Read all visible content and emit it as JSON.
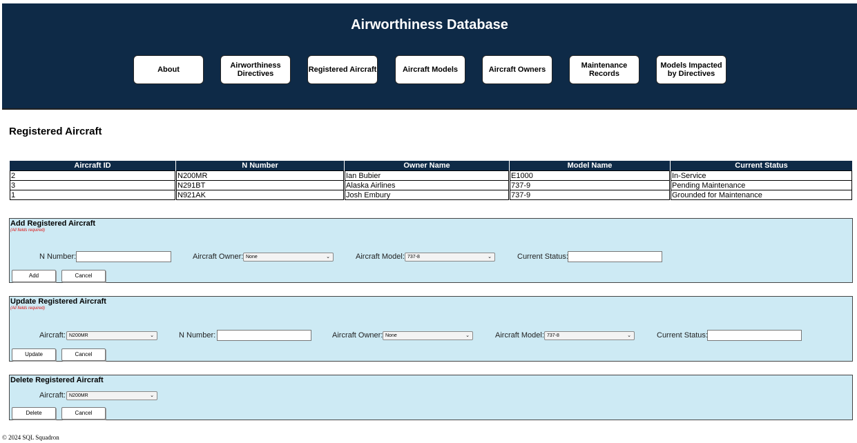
{
  "header": {
    "title": "Airworthiness Database",
    "nav": [
      {
        "label": "About"
      },
      {
        "label": "Airworthiness Directives"
      },
      {
        "label": "Registered Aircraft"
      },
      {
        "label": "Aircraft Models"
      },
      {
        "label": "Aircraft Owners"
      },
      {
        "label": "Maintenance Records"
      },
      {
        "label": "Models Impacted by Directives"
      }
    ]
  },
  "page": {
    "title": "Registered Aircraft"
  },
  "table": {
    "columns": [
      "Aircraft ID",
      "N Number",
      "Owner Name",
      "Model Name",
      "Current Status"
    ],
    "rows": [
      [
        "2",
        "N200MR",
        "Ian Bubier",
        "E1000",
        "In-Service"
      ],
      [
        "3",
        "N291BT",
        "Alaska Airlines",
        "737-9",
        "Pending Maintenance"
      ],
      [
        "1",
        "N921AK",
        "Josh Embury",
        "737-9",
        "Grounded for Maintenance"
      ]
    ]
  },
  "add_form": {
    "title": "Add Registered Aircraft",
    "note": "(All fields required)",
    "n_number_label": "N Number:",
    "owner_label": "Aircraft Owner:",
    "owner_value": "None",
    "model_label": "Aircraft Model:",
    "model_value": "737-8",
    "status_label": "Current Status:",
    "submit": "Add",
    "cancel": "Cancel"
  },
  "update_form": {
    "title": "Update Registered Aircraft",
    "note": "(All fields required)",
    "aircraft_label": "Aircraft:",
    "aircraft_value": "N200MR",
    "n_number_label": "N Number:",
    "owner_label": "Aircraft Owner:",
    "owner_value": "None",
    "model_label": "Aircraft Model:",
    "model_value": "737-8",
    "status_label": "Current Status:",
    "submit": "Update",
    "cancel": "Cancel"
  },
  "delete_form": {
    "title": "Delete Registered Aircraft",
    "aircraft_label": "Aircraft:",
    "aircraft_value": "N200MR",
    "submit": "Delete",
    "cancel": "Cancel"
  },
  "footer": {
    "text": "© 2024 SQL Squadron"
  }
}
